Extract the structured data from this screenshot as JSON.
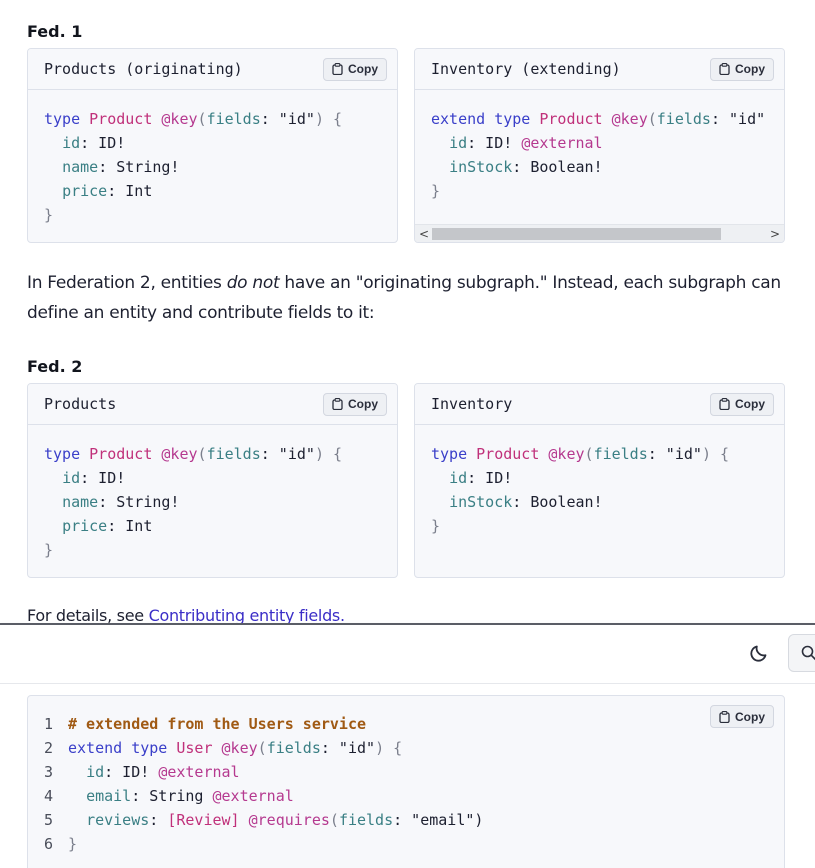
{
  "fed1": {
    "label": "Fed. 1",
    "left": {
      "title": "Products (originating)",
      "copy_label": "Copy",
      "lines": [
        [
          [
            "kw",
            "type "
          ],
          [
            "ty",
            "Product "
          ],
          [
            "dir",
            "@key"
          ],
          [
            "br",
            "("
          ],
          [
            "fld",
            "fields"
          ],
          [
            "str",
            ": \"id\""
          ],
          [
            "br",
            ") {"
          ]
        ],
        [
          [
            "str",
            "  "
          ],
          [
            "fld",
            "id"
          ],
          [
            "str",
            ": ID!"
          ]
        ],
        [
          [
            "str",
            "  "
          ],
          [
            "fld",
            "name"
          ],
          [
            "str",
            ": String!"
          ]
        ],
        [
          [
            "str",
            "  "
          ],
          [
            "fld",
            "price"
          ],
          [
            "str",
            ": Int"
          ]
        ],
        [
          [
            "br",
            "}"
          ]
        ]
      ]
    },
    "right": {
      "title": "Inventory (extending)",
      "copy_label": "Copy",
      "lines": [
        [
          [
            "kw",
            "extend type "
          ],
          [
            "ty",
            "Product "
          ],
          [
            "dir",
            "@key"
          ],
          [
            "br",
            "("
          ],
          [
            "fld",
            "fields"
          ],
          [
            "str",
            ": \"id\""
          ]
        ],
        [
          [
            "str",
            "  "
          ],
          [
            "fld",
            "id"
          ],
          [
            "str",
            ": ID! "
          ],
          [
            "dir",
            "@external"
          ]
        ],
        [
          [
            "str",
            "  "
          ],
          [
            "fld",
            "inStock"
          ],
          [
            "str",
            ": Boolean!"
          ]
        ],
        [
          [
            "br",
            "}"
          ]
        ]
      ],
      "scroll_left": "<",
      "scroll_right": ">"
    }
  },
  "paragraph": {
    "before": "In Federation 2, entities ",
    "emphasis": "do not",
    "after": " have an \"originating subgraph.\" Instead, each subgraph can define an entity and contribute fields to it:"
  },
  "fed2": {
    "label": "Fed. 2",
    "left": {
      "title": "Products",
      "copy_label": "Copy",
      "lines": [
        [
          [
            "kw",
            "type "
          ],
          [
            "ty",
            "Product "
          ],
          [
            "dir",
            "@key"
          ],
          [
            "br",
            "("
          ],
          [
            "fld",
            "fields"
          ],
          [
            "str",
            ": \"id\""
          ],
          [
            "br",
            ") {"
          ]
        ],
        [
          [
            "str",
            "  "
          ],
          [
            "fld",
            "id"
          ],
          [
            "str",
            ": ID!"
          ]
        ],
        [
          [
            "str",
            "  "
          ],
          [
            "fld",
            "name"
          ],
          [
            "str",
            ": String!"
          ]
        ],
        [
          [
            "str",
            "  "
          ],
          [
            "fld",
            "price"
          ],
          [
            "str",
            ": Int"
          ]
        ],
        [
          [
            "br",
            "}"
          ]
        ]
      ]
    },
    "right": {
      "title": "Inventory",
      "copy_label": "Copy",
      "lines": [
        [
          [
            "kw",
            "type "
          ],
          [
            "ty",
            "Product "
          ],
          [
            "dir",
            "@key"
          ],
          [
            "br",
            "("
          ],
          [
            "fld",
            "fields"
          ],
          [
            "str",
            ": \"id\""
          ],
          [
            "br",
            ") {"
          ]
        ],
        [
          [
            "str",
            "  "
          ],
          [
            "fld",
            "id"
          ],
          [
            "str",
            ": ID!"
          ]
        ],
        [
          [
            "str",
            "  "
          ],
          [
            "fld",
            "inStock"
          ],
          [
            "str",
            ": Boolean!"
          ]
        ],
        [
          [
            "br",
            "}"
          ]
        ]
      ]
    }
  },
  "details": {
    "prefix": "For details, see ",
    "link_text": "Contributing entity fields."
  },
  "bottom": {
    "copy_label": "Copy",
    "lines": [
      {
        "n": "1",
        "tokens": [
          [
            "cm",
            "# extended from the Users service"
          ]
        ]
      },
      {
        "n": "2",
        "tokens": [
          [
            "kw",
            "extend type "
          ],
          [
            "ty",
            "User "
          ],
          [
            "dir",
            "@key"
          ],
          [
            "br",
            "("
          ],
          [
            "fld",
            "fields"
          ],
          [
            "str",
            ": \"id\""
          ],
          [
            "br",
            ") {"
          ]
        ]
      },
      {
        "n": "3",
        "tokens": [
          [
            "str",
            "  "
          ],
          [
            "fld",
            "id"
          ],
          [
            "str",
            ": ID! "
          ],
          [
            "dir",
            "@external"
          ]
        ]
      },
      {
        "n": "4",
        "tokens": [
          [
            "str",
            "  "
          ],
          [
            "fld",
            "email"
          ],
          [
            "str",
            ": String "
          ],
          [
            "dir",
            "@external"
          ]
        ]
      },
      {
        "n": "5",
        "tokens": [
          [
            "str",
            "  "
          ],
          [
            "fld",
            "reviews"
          ],
          [
            "str",
            ": "
          ],
          [
            "ty",
            "[Review] "
          ],
          [
            "dir",
            "@requires"
          ],
          [
            "br",
            "("
          ],
          [
            "fld",
            "fields"
          ],
          [
            "str",
            ": \"email\")"
          ]
        ]
      },
      {
        "n": "6",
        "tokens": [
          [
            "br",
            "}"
          ]
        ]
      }
    ]
  },
  "icons": {
    "copy": "clipboard-icon",
    "theme": "moon-icon",
    "search": "search-icon"
  }
}
